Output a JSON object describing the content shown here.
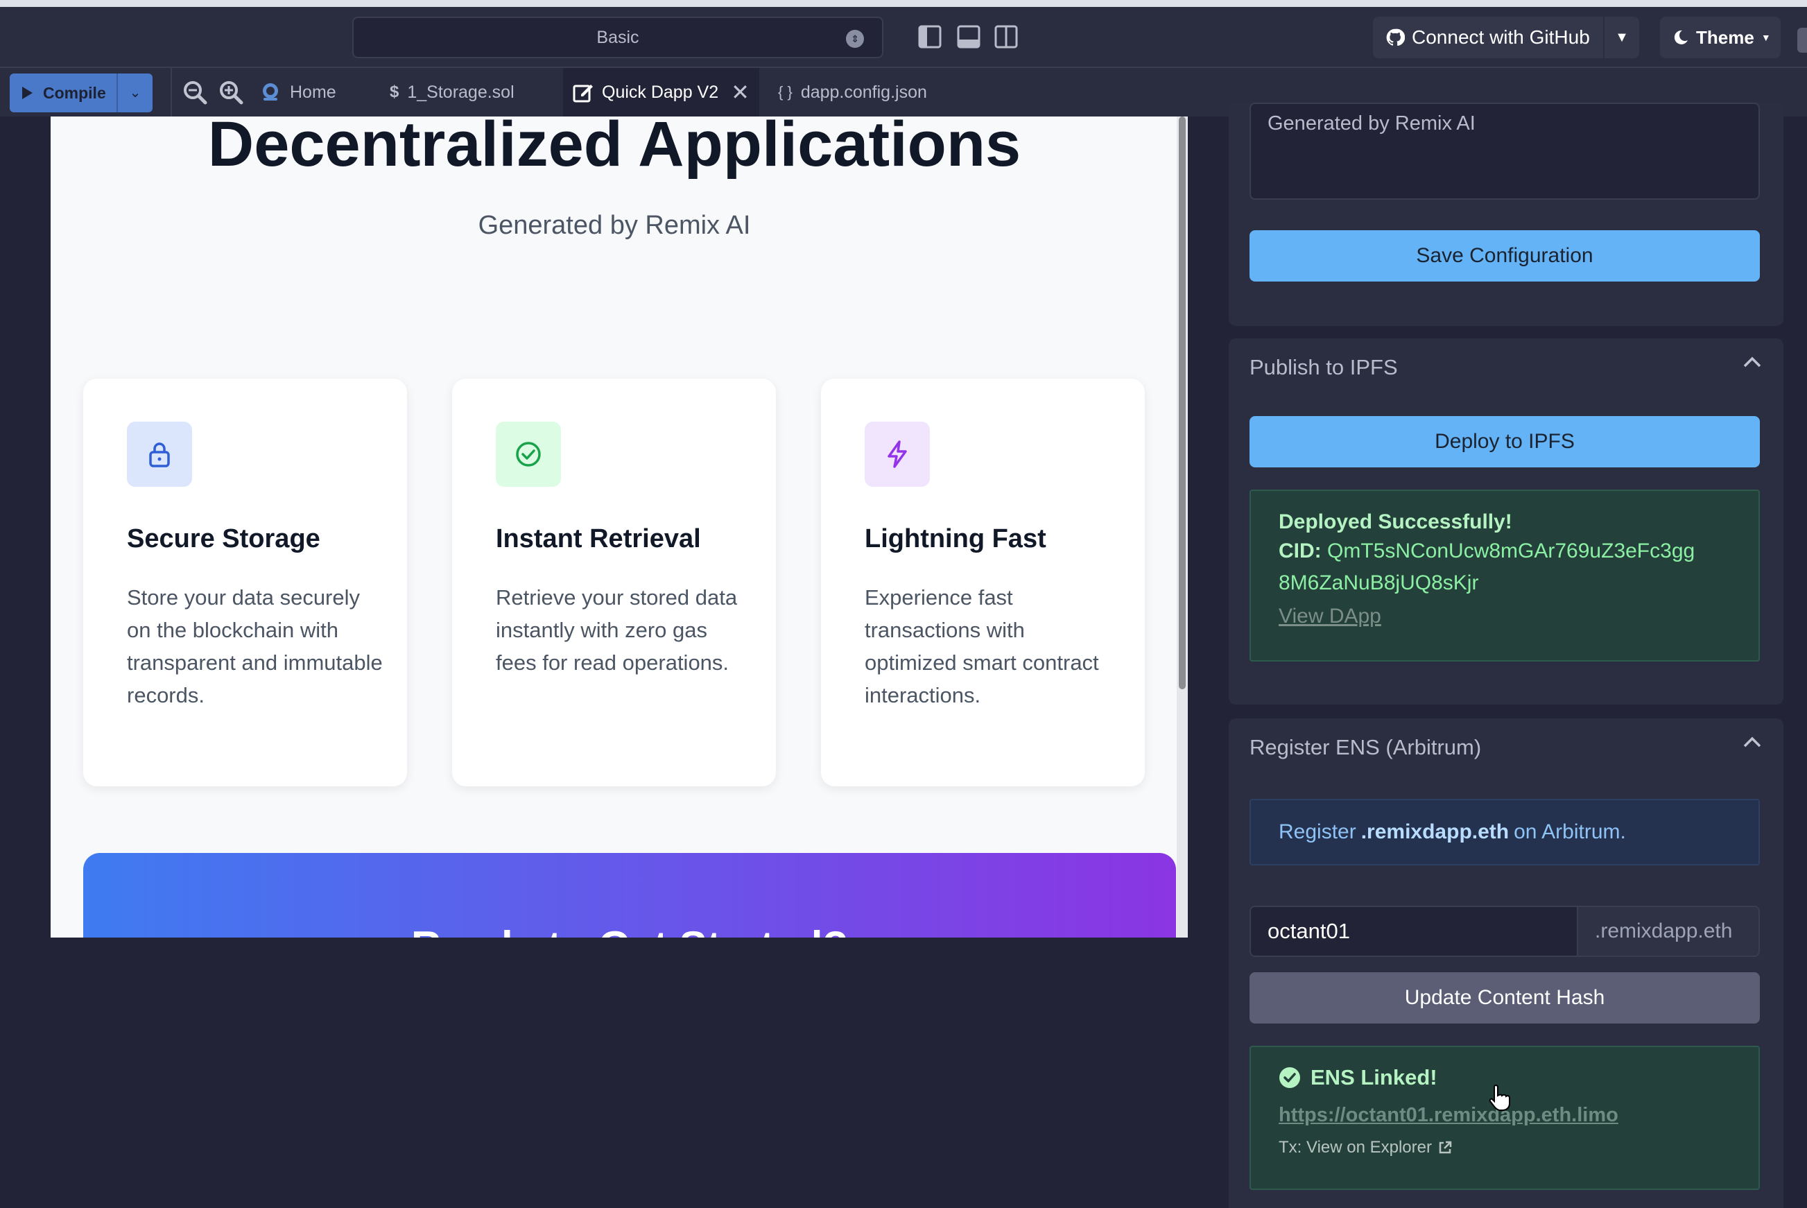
{
  "toolbar": {
    "mode_select": "Basic",
    "github_label": "Connect with GitHub",
    "theme_label": "Theme"
  },
  "tabs": {
    "compile_label": "Compile",
    "items": [
      {
        "label": "Home"
      },
      {
        "label": "1_Storage.sol"
      },
      {
        "label": "Quick Dapp V2"
      },
      {
        "label": "dapp.config.json"
      }
    ]
  },
  "preview": {
    "hero_title": "Decentralized Applications",
    "hero_subtitle": "Generated by Remix AI",
    "cards": [
      {
        "icon": "lock-icon",
        "title": "Secure Storage",
        "text": "Store your data securely on the blockchain with transparent and immutable records."
      },
      {
        "icon": "check-circle-icon",
        "title": "Instant Retrieval",
        "text": "Retrieve your stored data instantly with zero gas fees for read operations."
      },
      {
        "icon": "lightning-icon",
        "title": "Lightning Fast",
        "text": "Experience fast transactions with optimized smart contract interactions."
      }
    ],
    "cta_title": "Ready to Get Started?"
  },
  "panel": {
    "description_value": "Generated by Remix AI",
    "save_button": "Save Configuration",
    "ipfs": {
      "title": "Publish to IPFS",
      "deploy_button": "Deploy to IPFS",
      "success_title": "Deployed Successfully!",
      "cid_label": "CID:",
      "cid_value": "QmT5sNConUcw8mGAr769uZ3eFc3gg 8M6ZaNuB8jUQ8sKjr",
      "view_link": "View DApp"
    },
    "ens": {
      "title": "Register ENS (Arbitrum)",
      "info_prefix": "Register",
      "info_domain": ".remixdapp.eth",
      "info_suffix": "on Arbitrum.",
      "name_value": "octant01",
      "suffix": ".remixdapp.eth",
      "update_button": "Update Content Hash",
      "linked_title": "ENS Linked!",
      "linked_url": "https://octant01.remixdapp.eth.limo",
      "tx_label": "Tx: View on Explorer"
    }
  },
  "colors": {
    "background": "#222336",
    "panel": "#2b2d40",
    "primary_button": "#63b3f6",
    "success_text": "#b5f3c3",
    "success_link": "#8cf0a4",
    "cta_gradient_start": "#3f7bf1",
    "cta_gradient_end": "#8b35e2"
  }
}
